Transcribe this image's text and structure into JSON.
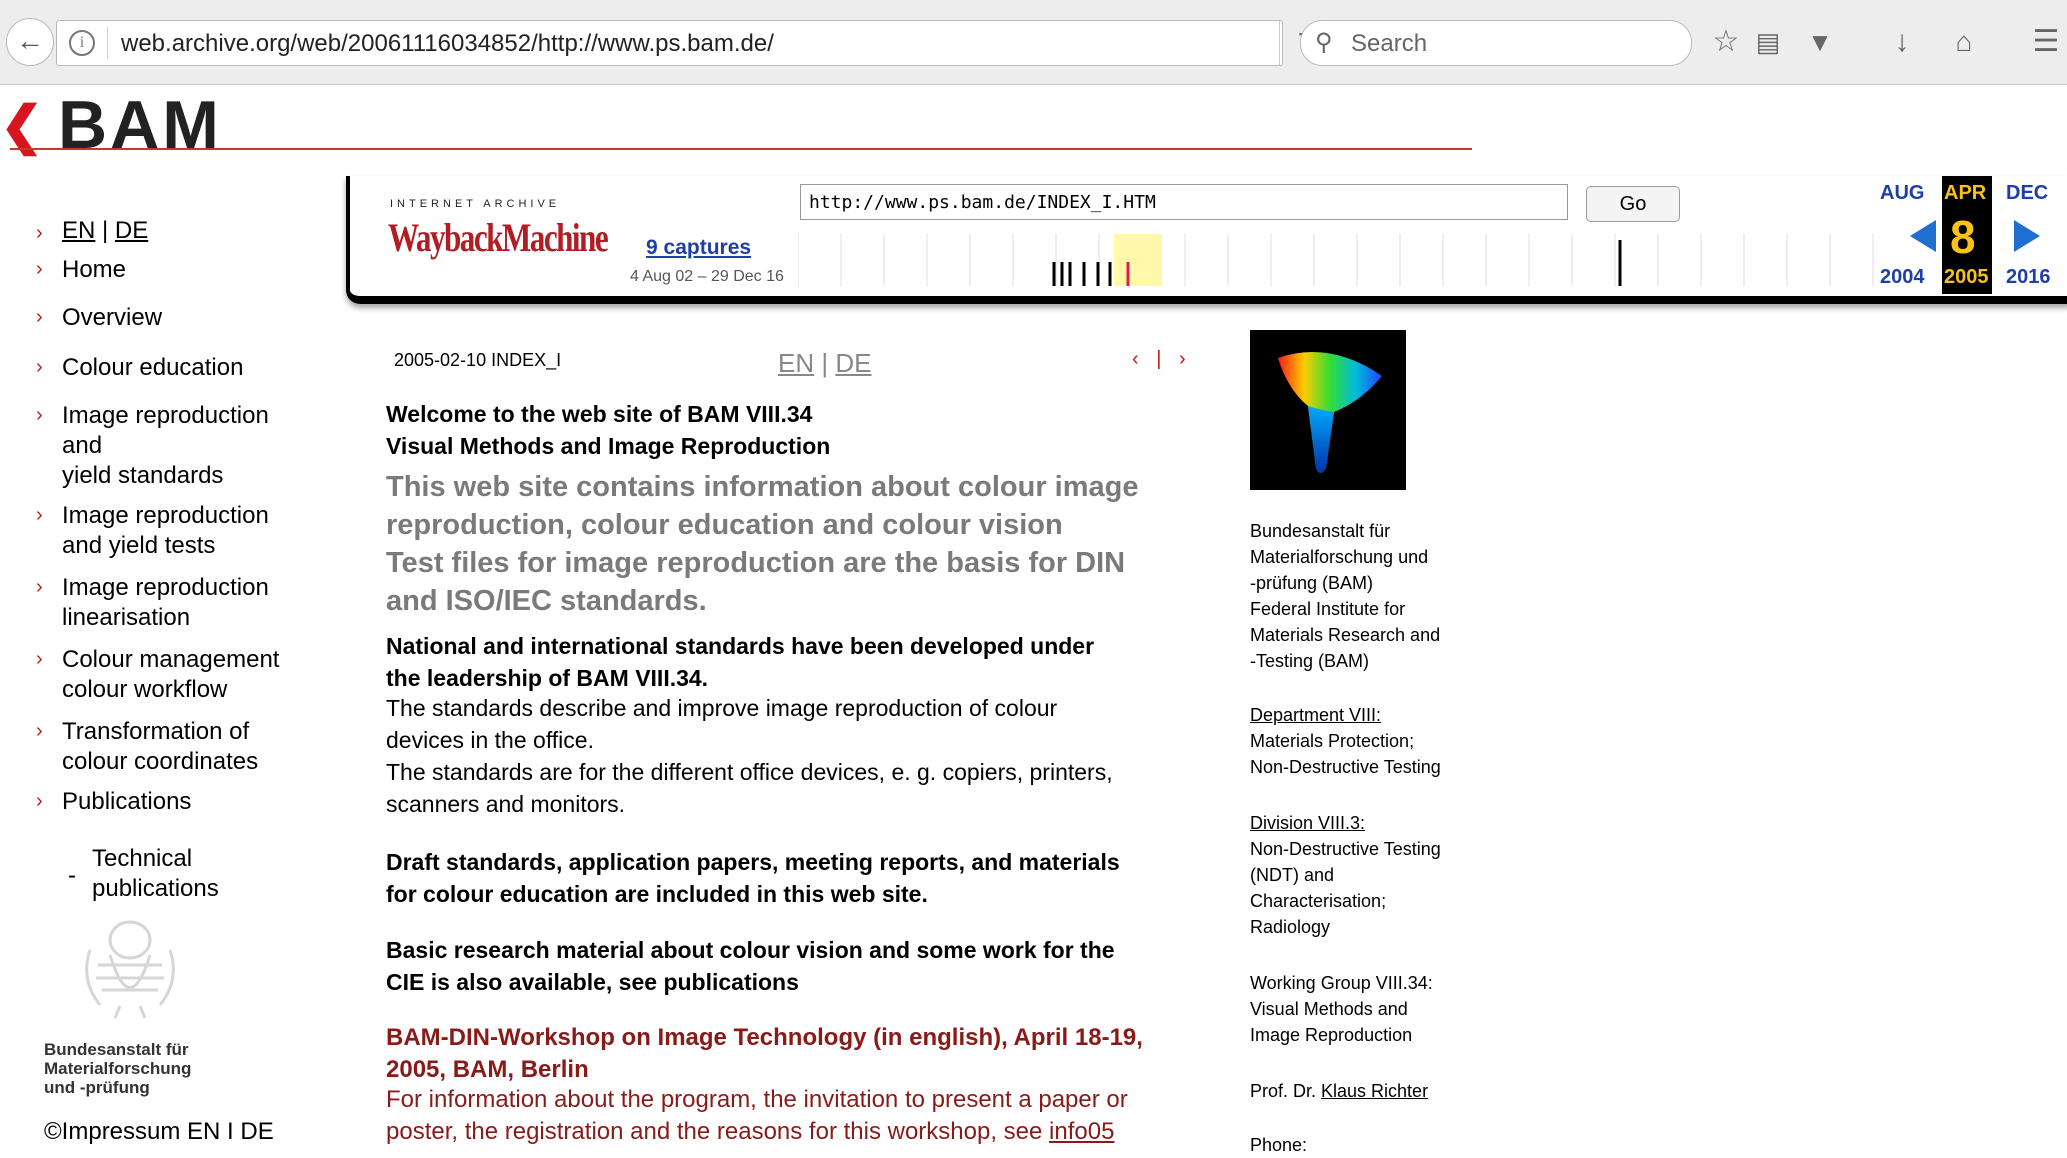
{
  "browser": {
    "url": "web.archive.org/web/20061116034852/http://www.ps.bam.de/",
    "search_placeholder": "Search"
  },
  "site": {
    "logo_text": "BAM"
  },
  "nav": {
    "lang_en": "EN",
    "lang_sep": "|",
    "lang_de": "DE",
    "items": [
      {
        "label": "Home"
      },
      {
        "label": "Overview"
      },
      {
        "label": "Colour education"
      },
      {
        "label": "Image reproduction"
      },
      {
        "label": "and"
      },
      {
        "label": "yield standards"
      },
      {
        "label": "Image reproduction"
      },
      {
        "label": "and yield tests"
      },
      {
        "label": "Image reproduction"
      },
      {
        "label": "linearisation"
      },
      {
        "label": "Colour management"
      },
      {
        "label": "colour workflow"
      },
      {
        "label": "Transformation of"
      },
      {
        "label": "colour coordinates"
      },
      {
        "label": "Publications"
      }
    ],
    "sub_dash": "-",
    "sub_line1": "Technical",
    "sub_line2": "publications",
    "inst_line1": "Bundesanstalt für",
    "inst_line2": "Materialforschung",
    "inst_line3": "und -prüfung",
    "impressum": "©Impressum EN I DE"
  },
  "wayback": {
    "ia_label": "INTERNET ARCHIVE",
    "wm_label": "WaybackMachine",
    "url_value": "http://www.ps.bam.de/INDEX_I.HTM",
    "go_label": "Go",
    "captures": "9 captures",
    "range": "4 Aug 02 – 29 Dec 16",
    "prev_month": "AUG",
    "cur_month": "APR",
    "next_month": "DEC",
    "cur_day": "8",
    "prev_year": "2004",
    "cur_year": "2005",
    "next_year": "2016"
  },
  "content": {
    "datestamp": "2005-02-10 INDEX_I",
    "lang_en": "EN",
    "lang_sep": "|",
    "lang_de": "DE",
    "pager": "‹ | ›",
    "welcome1": "Welcome to the web site of BAM VIII.34",
    "welcome2": "Visual Methods and Image Reproduction",
    "grey1": "This web site contains information about colour image",
    "grey2": "reproduction, colour education and colour vision",
    "grey3": "Test files for image reproduction are the basis for DIN",
    "grey4": "and ISO/IEC standards.",
    "nat1": "National and international standards have been developed under",
    "nat2": "the leadership of BAM VIII.34.",
    "std1": "The standards describe and improve image reproduction of colour",
    "std2": "devices in the office.",
    "std3": "The standards are for the different office devices, e. g. copiers, printers,",
    "std4": "scanners and monitors.",
    "draft1": "Draft standards, application papers, meeting reports, and materials",
    "draft2": "for colour education are included in this web site.",
    "basic1": "Basic research material about colour vision and some work for the",
    "basic2": "CIE is also available, see publications",
    "ws1": "BAM-DIN-Workshop on Image Technology (in english), April 18-19,",
    "ws2": "2005, BAM, Berlin",
    "info1": "For information about the program, the invitation to present a paper or",
    "info2": "poster, the registration and the reasons for this workshop, see",
    "info_link": "info05"
  },
  "right": {
    "r1": "Bundesanstalt für",
    "r2": "Materialforschung und",
    "r3": "-prüfung (BAM)",
    "r4": "Federal Institute for",
    "r5": "Materials Research and",
    "r6": "-Testing (BAM)",
    "dept_link": "Department VIII:",
    "dept1": "Materials Protection;",
    "dept2": "Non-Destructive Testing",
    "div_link": "Division VIII.3:",
    "div1": "Non-Destructive Testing",
    "div2": "(NDT) and",
    "div3": "Characterisation;",
    "div4": "Radiology",
    "wg1": "Working Group VIII.34:",
    "wg2": "Visual Methods and",
    "wg3": "Image Reproduction",
    "prof_prefix": "Prof. Dr. ",
    "prof_link": "Klaus Richter",
    "phone": "Phone:"
  },
  "colors": {
    "bam_red": "#d8151e",
    "link_blue": "#1e3ea8",
    "workshop_red": "#8a1a17"
  }
}
